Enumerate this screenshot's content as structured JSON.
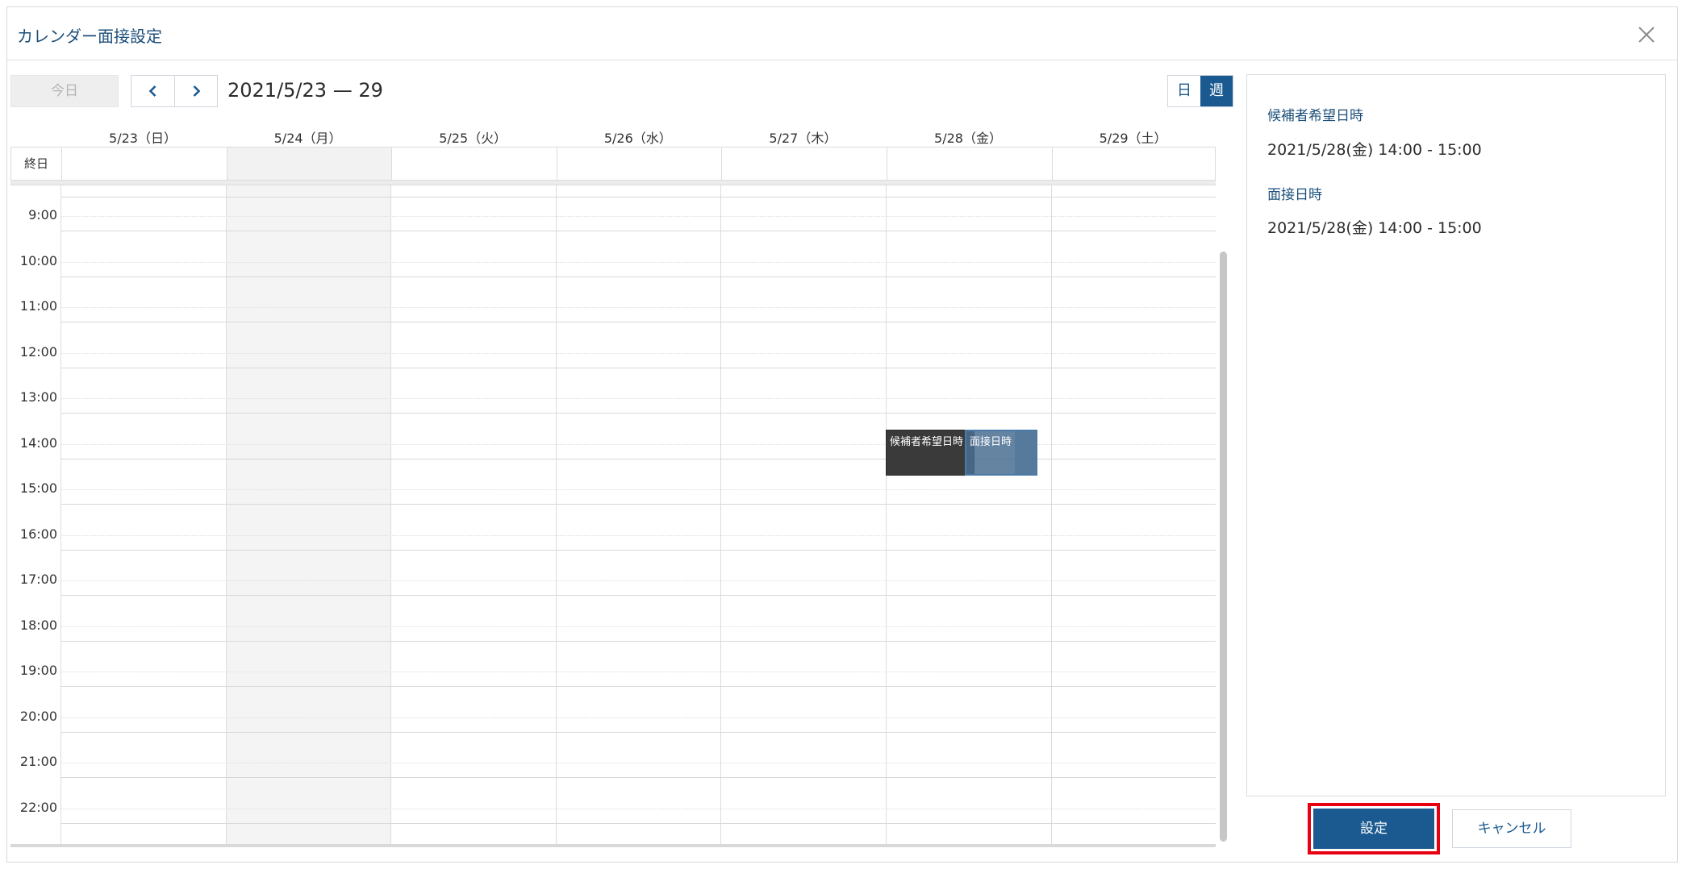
{
  "dialog": {
    "title": "カレンダー面接設定"
  },
  "toolbar": {
    "today_label": "今日",
    "date_range": "2021/5/23 — 29",
    "view_day_label": "日",
    "view_week_label": "週",
    "active_view": "週"
  },
  "calendar": {
    "allday_label": "終日",
    "days": [
      "5/23（日）",
      "5/24（月）",
      "5/25（火）",
      "5/26（水）",
      "5/27（木）",
      "5/28（金）",
      "5/29（土）"
    ],
    "shaded_day": "5/24（月）",
    "hours": [
      "9:00",
      "10:00",
      "11:00",
      "12:00",
      "13:00",
      "14:00",
      "15:00",
      "16:00",
      "17:00",
      "18:00",
      "19:00",
      "20:00",
      "21:00",
      "22:00"
    ],
    "events": {
      "candidate": {
        "label": "候補者希望日時",
        "day": "5/28（金）",
        "start": "14:00",
        "end": "15:00"
      },
      "interview": {
        "label": "面接日時",
        "day": "5/28（金）",
        "start": "14:00",
        "end": "15:00"
      }
    }
  },
  "info": {
    "candidate_heading": "候補者希望日時",
    "candidate_value": "2021/5/28(金) 14:00 - 15:00",
    "interview_heading": "面接日時",
    "interview_value": "2021/5/28(金) 14:00 - 15:00"
  },
  "footer": {
    "save_label": "設定",
    "cancel_label": "キャンセル"
  },
  "colors": {
    "primary": "#1a5a91",
    "title": "#1c4f7a",
    "highlight": "#e60012",
    "candidate_event": "#3a3a3a",
    "interview_event": "#4a6f92"
  },
  "icons": [
    "close-icon",
    "chevron-left-icon",
    "chevron-right-icon"
  ]
}
